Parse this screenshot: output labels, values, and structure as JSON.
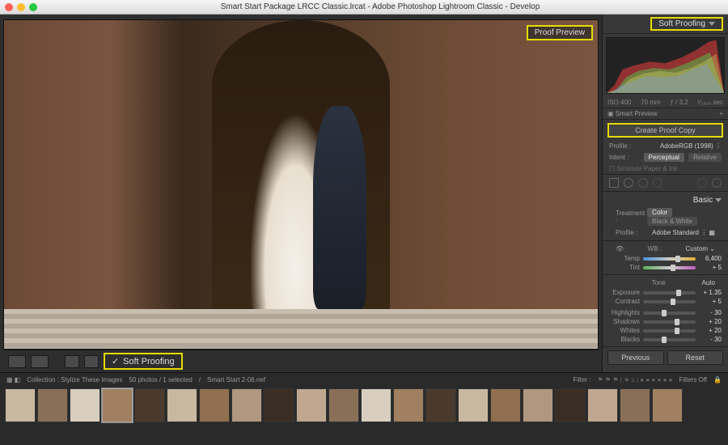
{
  "titlebar": {
    "title": "Smart Start Package LRCC Classic.lrcat - Adobe Photoshop Lightroom Classic - Develop"
  },
  "preview": {
    "overlay_label": "Proof Preview"
  },
  "bottom_toolbar": {
    "soft_proofing_label": "Soft Proofing"
  },
  "right_panel": {
    "soft_proofing_header": "Soft Proofing",
    "meta": {
      "iso": "ISO 400",
      "focal": "70 mm",
      "aperture": "ƒ / 3.2",
      "shutter": "¹⁄₂₅₀₀ sec"
    },
    "smart_preview": "Smart Preview",
    "proof_copy": "Create Proof Copy",
    "profile_label": "Profile :",
    "profile_value": "AdobeRGB (1998)",
    "intent_label": "Intent :",
    "intent_value": "Perceptual",
    "intent_alt": "Relative",
    "simulate": "Simulate Paper & Ink",
    "basic_label": "Basic",
    "treatment_label": "Treatment :",
    "treatment_color": "Color",
    "treatment_bw": "Black & White",
    "profile2_label": "Profile :",
    "profile2_value": "Adobe Standard",
    "wb_label": "WB :",
    "wb_value": "Custom",
    "sliders": {
      "temp": {
        "label": "Temp",
        "value": "6,400"
      },
      "tint": {
        "label": "Tint",
        "value": "+ 5"
      },
      "tone": "Tone",
      "auto": "Auto",
      "exposure": {
        "label": "Exposure",
        "value": "+ 1.35"
      },
      "contrast": {
        "label": "Contrast",
        "value": "+ 5"
      },
      "highlights": {
        "label": "Highlights",
        "value": "- 30"
      },
      "shadows": {
        "label": "Shadows",
        "value": "+ 20"
      },
      "whites": {
        "label": "Whites",
        "value": "+ 20"
      },
      "blacks": {
        "label": "Blacks",
        "value": "- 30"
      }
    },
    "previous": "Previous",
    "reset": "Reset"
  },
  "filmstrip": {
    "collection_label": "Collection : Stylize These Images",
    "count": "50 photos / 1 selected",
    "path": "Smart Start 2-06.nef",
    "filter_label": "Filter :",
    "filters_off": "Filters Off",
    "thumb_variants": [
      "#c8b8a0",
      "#8a6f58",
      "#d8cec0",
      "#a08060",
      "#4a3a2e",
      "#c8b8a0",
      "#907050",
      "#b09880",
      "#3a2e24",
      "#c0a890",
      "#8a6f58",
      "#d8cec0",
      "#a08060",
      "#4a3a2e",
      "#c8b8a0",
      "#907050",
      "#b09880",
      "#3a2e24",
      "#c0a890",
      "#8a6f58",
      "#a08060"
    ]
  }
}
